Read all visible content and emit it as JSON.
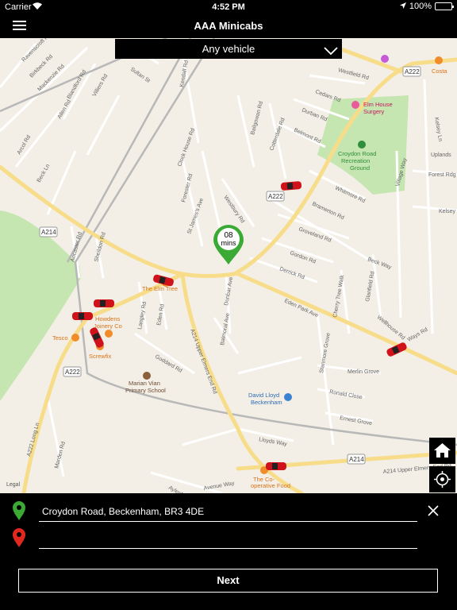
{
  "status_bar": {
    "carrier": "Carrier",
    "time": "4:52 PM",
    "battery": "100%",
    "battery_level": 1.0
  },
  "nav": {
    "title": "AAA Minicabs"
  },
  "vehicle_selector": {
    "value": "Any vehicle"
  },
  "eta": {
    "value": "08",
    "unit": "mins"
  },
  "map": {
    "legal": "Legal",
    "streets": [
      "Ravenscroft Rd",
      "Birkbeck Rd",
      "Mackenzie Rd",
      "Blandford Rd",
      "Allen Rd",
      "Villiers Rd",
      "Sultan St",
      "Kendall Rd",
      "Westfield Rd",
      "Cedars Rd",
      "Durban Rd",
      "Belmont Rd",
      "Clock House Rd",
      "Bailgowan Rd",
      "Cotterdale Rd",
      "Whitmore Rd",
      "Bramerton Rd",
      "Kelsey Ln",
      "Forest Rdg",
      "Kelsey Pk",
      "Uplands",
      "Village Way",
      "Arcol Rd",
      "Beck Ln",
      "Forester Rd",
      "St James's Ave",
      "Westbury Rd",
      "Groveland Rd",
      "Gordon Rd",
      "Derrick Rd",
      "Beck Way",
      "Ancaster Rd",
      "Sheildon Rd",
      "Langley Rd",
      "Eden Rd",
      "Dunbar Ave",
      "Eden Park Ave",
      "Merlin Grove",
      "Ronald Close",
      "Ernest Grove",
      "Lloyds Way",
      "Goddard Rd",
      "Upper Elmers End Rd",
      "Long Ln",
      "Marden Rd",
      "Aylesford Ave",
      "Cherry Tree Walk",
      "Glanfield Rd",
      "Wellhouse Rd",
      "Stanmore Grove",
      "Balmoral Ave",
      "Avenue Way"
    ],
    "roads": [
      "A222",
      "A214",
      "A222",
      "A214",
      "A222"
    ],
    "places": [
      "Elm House Surgery",
      "Croydon Road Recreation Ground",
      "The Elm Tree",
      "Howdens Joinery Co",
      "Tesco",
      "Screwfix",
      "Marian Vian Primary School",
      "David Lloyd Beckenham",
      "The Co-operative Food",
      "Costa"
    ]
  },
  "booking": {
    "pickup": "Croydon Road, Beckenham, BR3 4DE",
    "dropoff": "",
    "next_label": "Next"
  },
  "colors": {
    "accent_green": "#3aaa35",
    "dropoff_red": "#e1281e",
    "car_red": "#d0121b",
    "park": "#c5e6b0"
  }
}
